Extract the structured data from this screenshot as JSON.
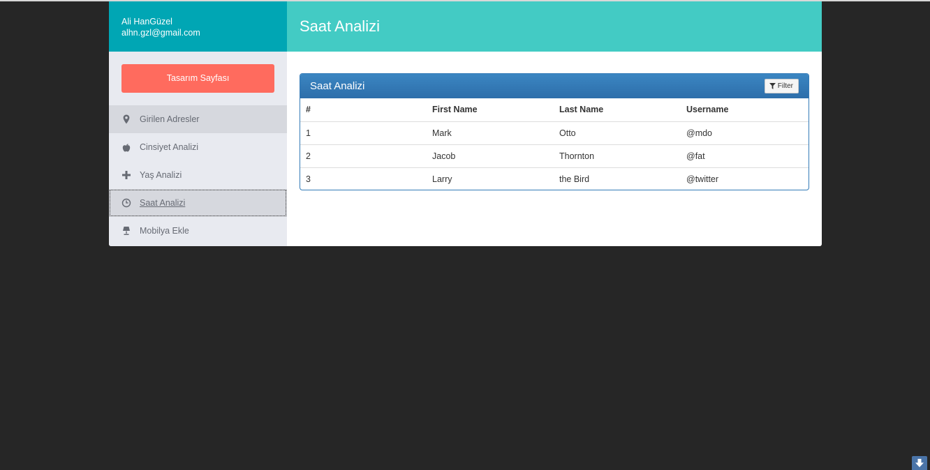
{
  "user": {
    "name": "Ali HanGüzel",
    "email": "alhn.gzl@gmail.com"
  },
  "sidebar": {
    "cta_label": "Tasarım Sayfası",
    "items": [
      {
        "label": "Girilen Adresler",
        "icon": "map-marker-icon"
      },
      {
        "label": "Cinsiyet Analizi",
        "icon": "apple-icon"
      },
      {
        "label": "Yaş Analizi",
        "icon": "plus-icon"
      },
      {
        "label": "Saat Analizi",
        "icon": "clock-icon"
      },
      {
        "label": "Mobilya Ekle",
        "icon": "lamp-icon"
      }
    ]
  },
  "header": {
    "title": "Saat Analizi"
  },
  "panel": {
    "title": "Saat Analizi",
    "filter_label": "Filter",
    "columns": [
      "#",
      "First Name",
      "Last Name",
      "Username"
    ],
    "rows": [
      [
        "1",
        "Mark",
        "Otto",
        "@mdo"
      ],
      [
        "2",
        "Jacob",
        "Thornton",
        "@fat"
      ],
      [
        "3",
        "Larry",
        "the Bird",
        "@twitter"
      ]
    ]
  },
  "colors": {
    "profile_bg": "#00a6b4",
    "header_bg": "#43cbc4",
    "cta_bg": "#ff6b5e",
    "panel_primary": "#337ab7",
    "page_bg": "#262626"
  }
}
